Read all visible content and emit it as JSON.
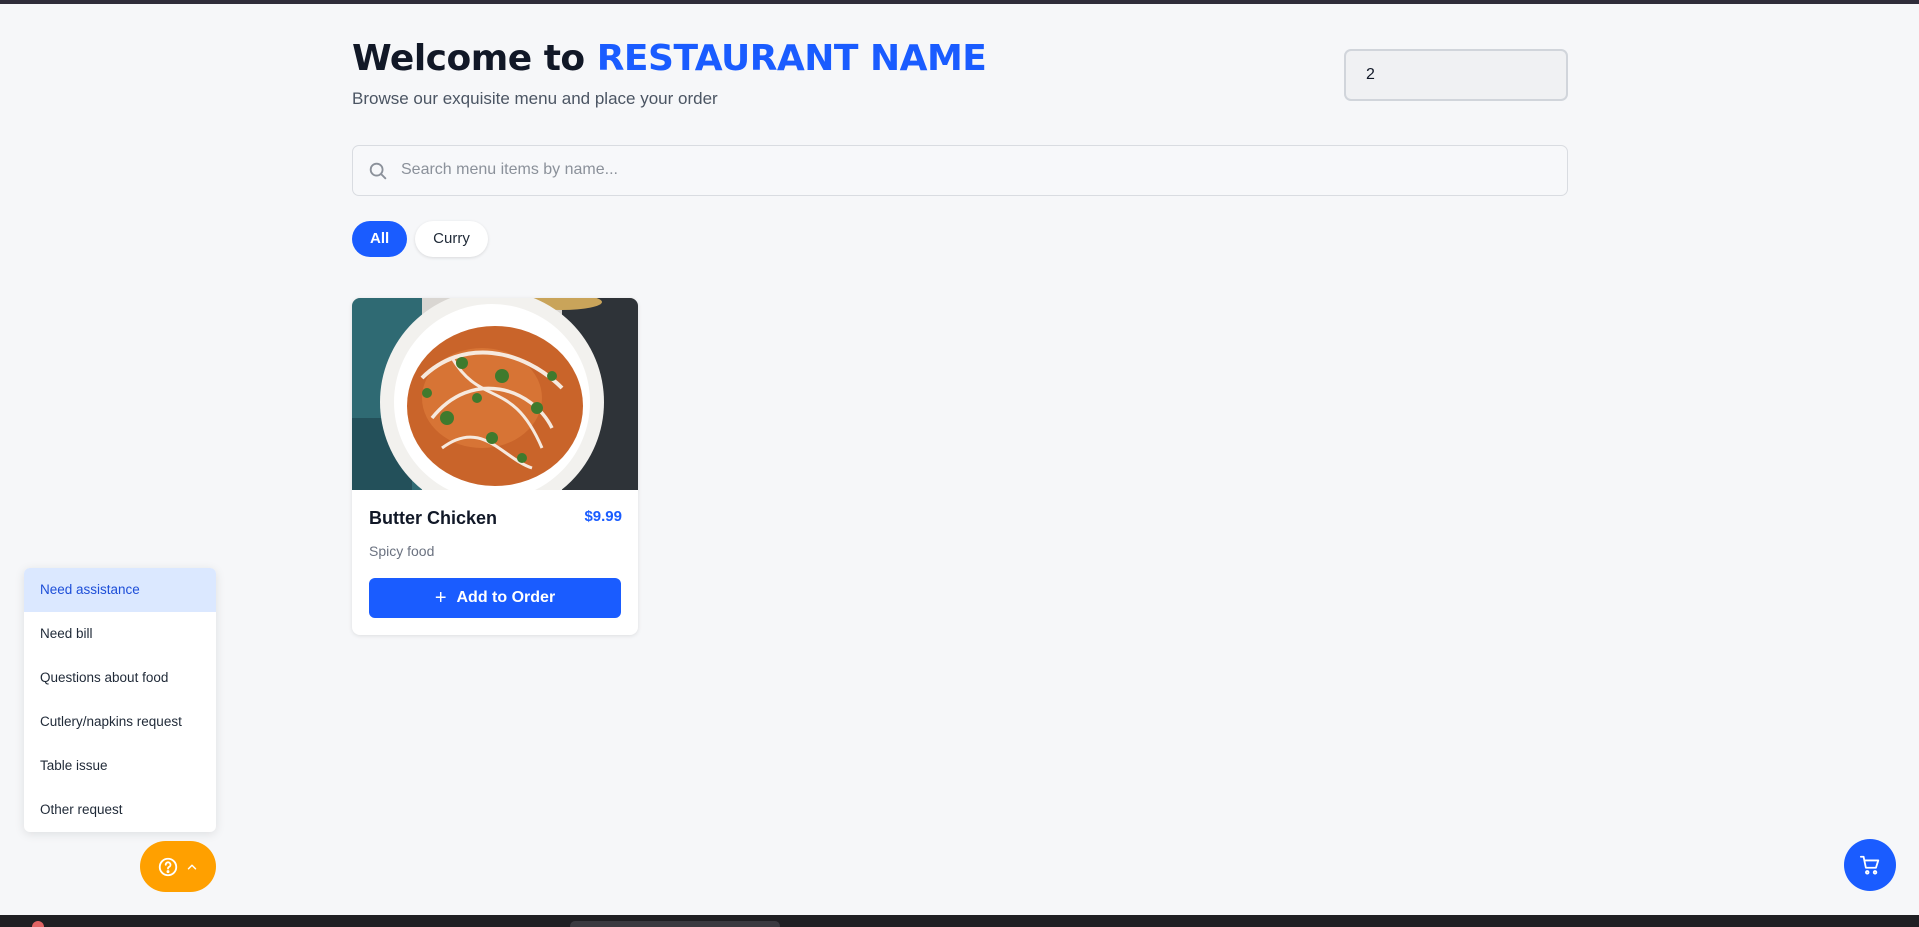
{
  "header": {
    "title_prefix": "Welcome to ",
    "restaurant_name": "RESTAURANT NAME",
    "subtitle": "Browse our exquisite menu and place your order",
    "table_number": "2"
  },
  "search": {
    "placeholder": "Search menu items by name...",
    "value": ""
  },
  "categories": [
    {
      "label": "All",
      "active": true
    },
    {
      "label": "Curry",
      "active": false
    }
  ],
  "menu_items": [
    {
      "name": "Butter Chicken",
      "price": "$9.99",
      "description": "Spicy food",
      "button_label": "Add to Order"
    }
  ],
  "request_menu": {
    "items": [
      {
        "label": "Need assistance",
        "highlighted": true
      },
      {
        "label": "Need bill"
      },
      {
        "label": "Questions about food"
      },
      {
        "label": "Cutlery/napkins request"
      },
      {
        "label": "Table issue"
      },
      {
        "label": "Other request"
      }
    ]
  },
  "fabs": {
    "help_icon": "help-circle-icon",
    "chevron_icon": "chevron-up-icon",
    "cart_icon": "shopping-cart-icon"
  },
  "colors": {
    "accent": "#1a5cff",
    "help_button": "#ffa000",
    "background": "#f6f7f9",
    "highlight": "#dbe8ff"
  }
}
